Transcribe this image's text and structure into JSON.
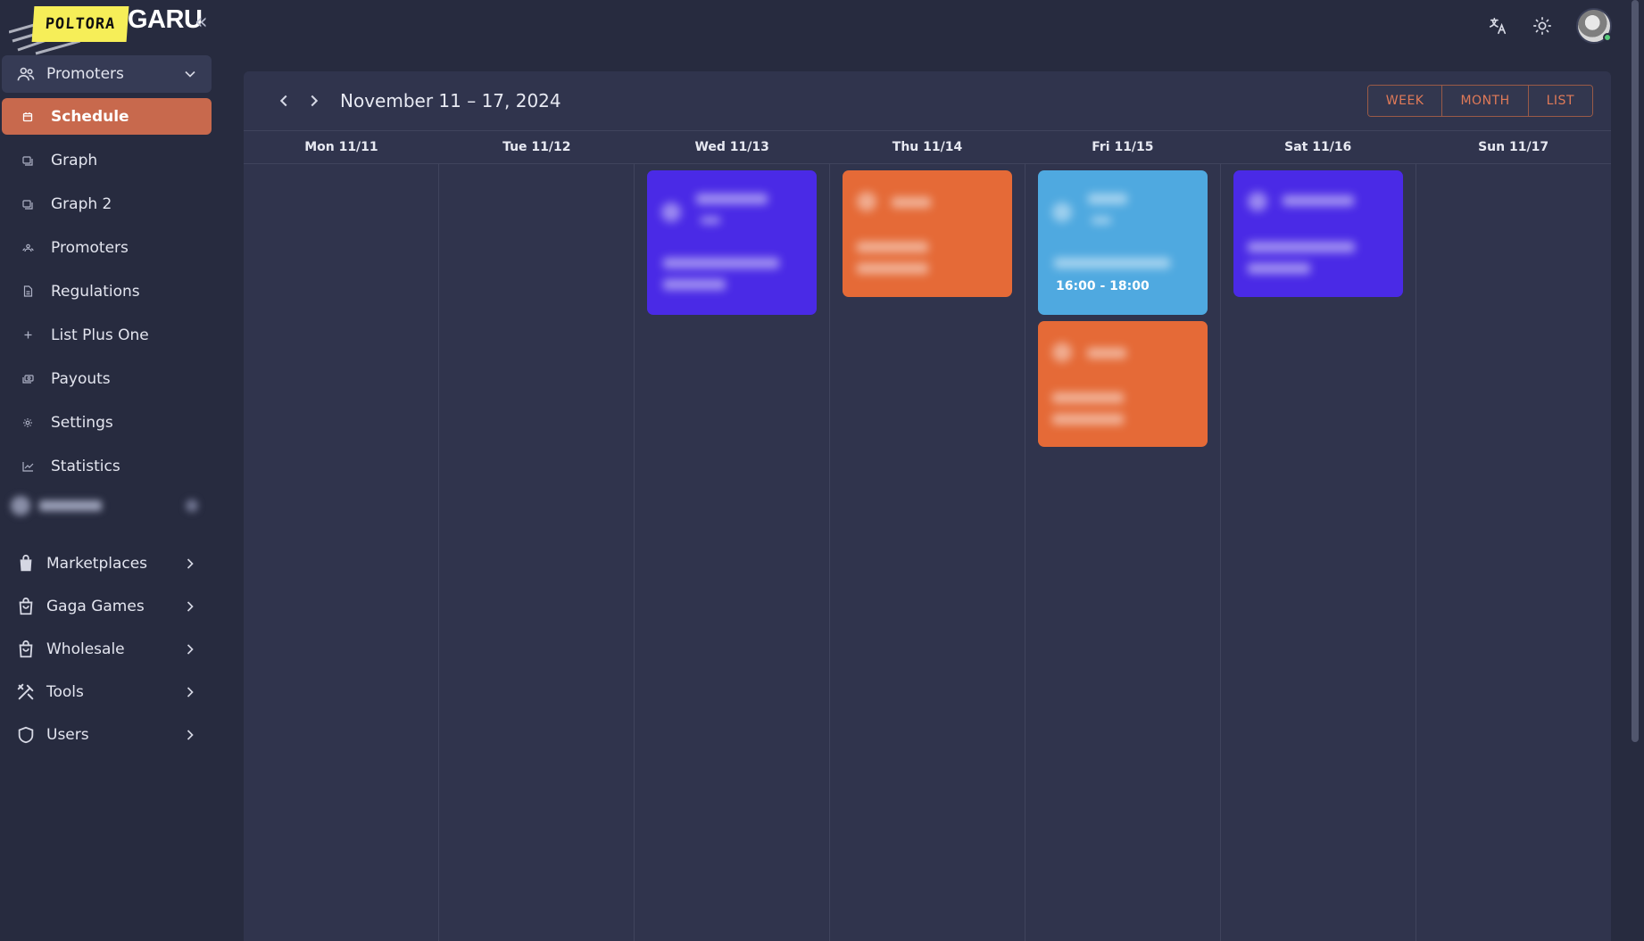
{
  "logo": {
    "mark_text": "POLTORA",
    "word_text": "GARU",
    "collapse_label": "«"
  },
  "header": {
    "actions": [
      "translate-icon",
      "brightness-icon",
      "user-avatar"
    ]
  },
  "sidebar": {
    "groups_top": {
      "label": "Promoters",
      "icon": "users-icon"
    },
    "items": [
      {
        "label": "Schedule",
        "icon": "calendar-icon",
        "active": true
      },
      {
        "label": "Graph",
        "icon": "chart-icon"
      },
      {
        "label": "Graph 2",
        "icon": "chart-icon"
      },
      {
        "label": "Promoters",
        "icon": "users-icon"
      },
      {
        "label": "Regulations",
        "icon": "file-icon"
      },
      {
        "label": "List Plus One",
        "icon": "plus-icon"
      },
      {
        "label": "Payouts",
        "icon": "cash-icon"
      },
      {
        "label": "Settings",
        "icon": "gear-icon"
      },
      {
        "label": "Statistics",
        "icon": "trend-icon"
      }
    ],
    "groups_bottom": [
      {
        "label": "Marketplaces",
        "icon": "bag-icon"
      },
      {
        "label": "Gaga Games",
        "icon": "bag-icon"
      },
      {
        "label": "Wholesale",
        "icon": "bag-icon"
      },
      {
        "label": "Tools",
        "icon": "tools-icon"
      },
      {
        "label": "Users",
        "icon": "shield-icon"
      }
    ]
  },
  "calendar": {
    "title": "November 11 – 17, 2024",
    "views": [
      "WEEK",
      "MONTH",
      "LIST"
    ],
    "days": [
      "Mon 11/11",
      "Tue 11/12",
      "Wed 11/13",
      "Thu 11/14",
      "Fri 11/15",
      "Sat 11/16",
      "Sun 11/17"
    ],
    "events": [
      {
        "day": "Wed 11/13",
        "color": "#4a2ae6",
        "time": ""
      },
      {
        "day": "Thu 11/14",
        "color": "#e56a37",
        "time": ""
      },
      {
        "day": "Fri 11/15",
        "color": "#4fa9e0",
        "time": "16:00 - 18:00"
      },
      {
        "day": "Fri 11/15",
        "color": "#e56a37",
        "time": ""
      },
      {
        "day": "Sat 11/16",
        "color": "#4a2ae6",
        "time": ""
      }
    ]
  },
  "colors": {
    "accent": "#c8694d",
    "background": "#272b3f",
    "panel": "#30344d"
  }
}
